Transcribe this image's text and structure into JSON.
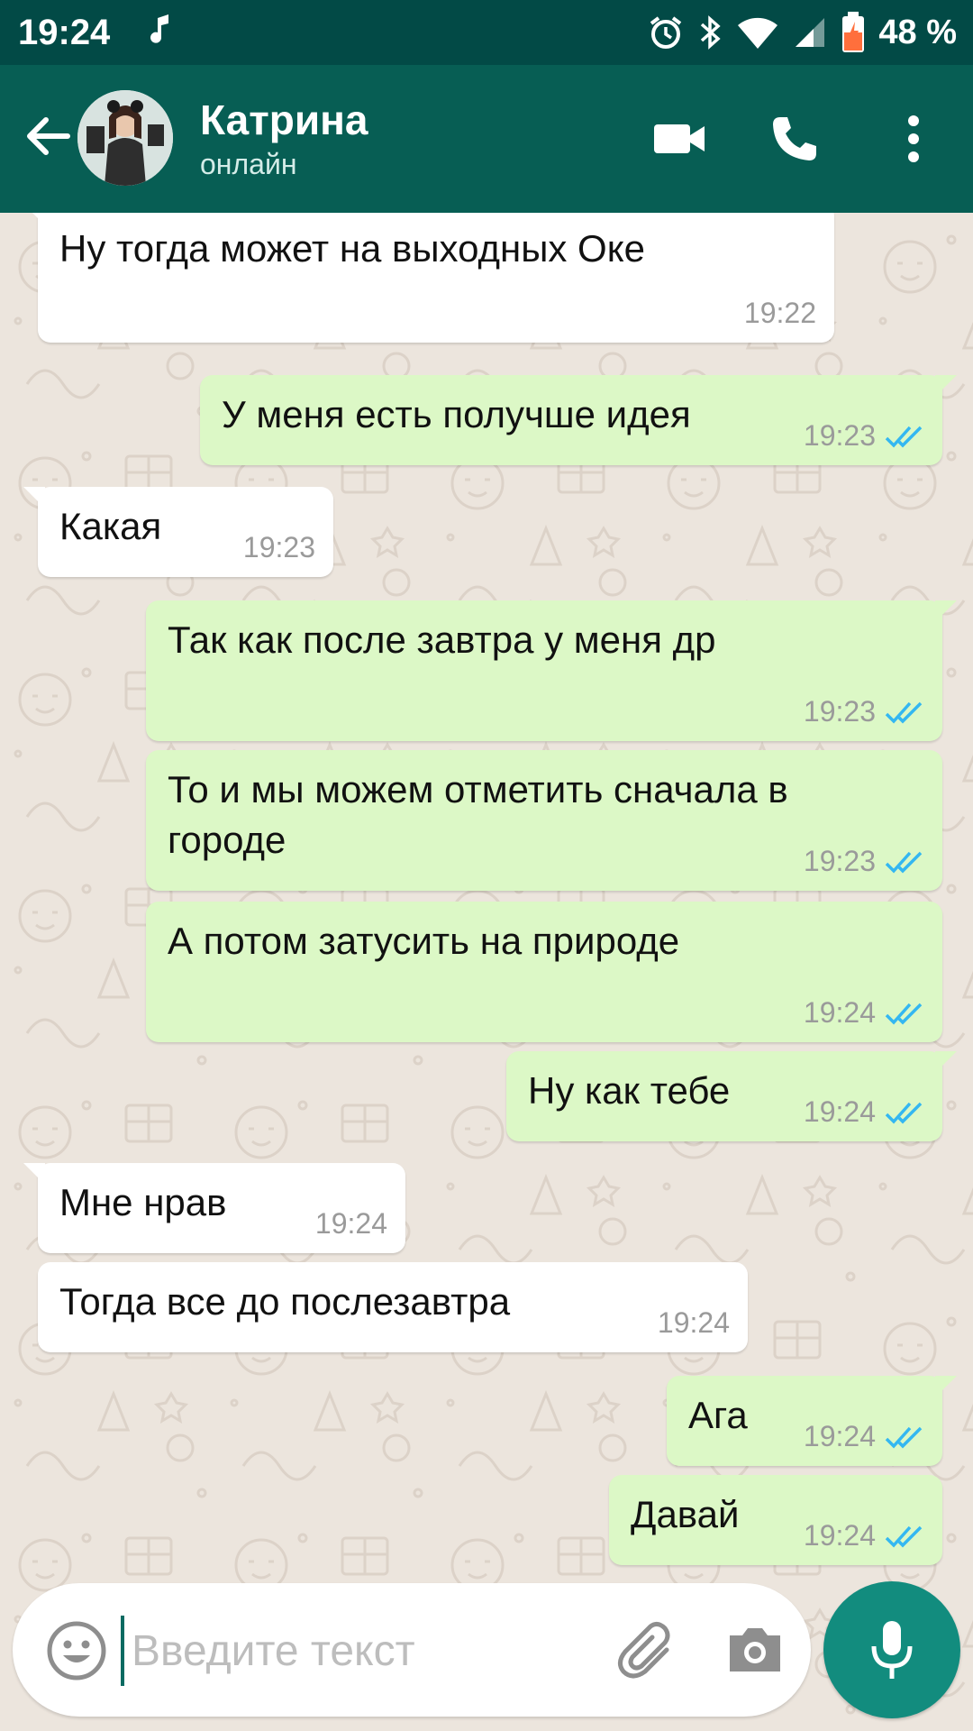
{
  "status_bar": {
    "time": "19:24",
    "battery_pct": "48 %"
  },
  "header": {
    "contact_name": "Катрина",
    "contact_status": "онлайн",
    "icons": [
      "back-arrow-icon",
      "video-call-icon",
      "phone-icon",
      "more-vert-icon"
    ]
  },
  "messages": [
    {
      "dir": "in",
      "text": "Ну тогда может на выходных Оке",
      "time": "19:22"
    },
    {
      "dir": "out",
      "text": "У меня есть получше идея",
      "time": "19:23",
      "read": true
    },
    {
      "dir": "in",
      "text": "Какая",
      "time": "19:23"
    },
    {
      "dir": "out",
      "text": "Так как после завтра у меня др",
      "time": "19:23",
      "read": true
    },
    {
      "dir": "out",
      "text": "То и мы можем отметить сначала в городе",
      "time": "19:23",
      "read": true
    },
    {
      "dir": "out",
      "text": "А потом затусить на природе",
      "time": "19:24",
      "read": true
    },
    {
      "dir": "out",
      "text": "Ну как тебе",
      "time": "19:24",
      "read": true
    },
    {
      "dir": "in",
      "text": "Мне нрав",
      "time": "19:24"
    },
    {
      "dir": "in",
      "text": "Тогда все до послезавтра",
      "time": "19:24"
    },
    {
      "dir": "out",
      "text": "Ага",
      "time": "19:24",
      "read": true
    },
    {
      "dir": "out",
      "text": "Давай",
      "time": "19:24",
      "read": true
    }
  ],
  "composer": {
    "placeholder": "Введите текст",
    "value": ""
  },
  "colors": {
    "app_bar": "#075E54",
    "status_bar": "#024A46",
    "outgoing_bubble": "#DCF8C6",
    "incoming_bubble": "#FFFFFF",
    "read_checks": "#34B7F1",
    "wallpaper": "#ECE5DD",
    "mic_button": "#128C7E"
  }
}
